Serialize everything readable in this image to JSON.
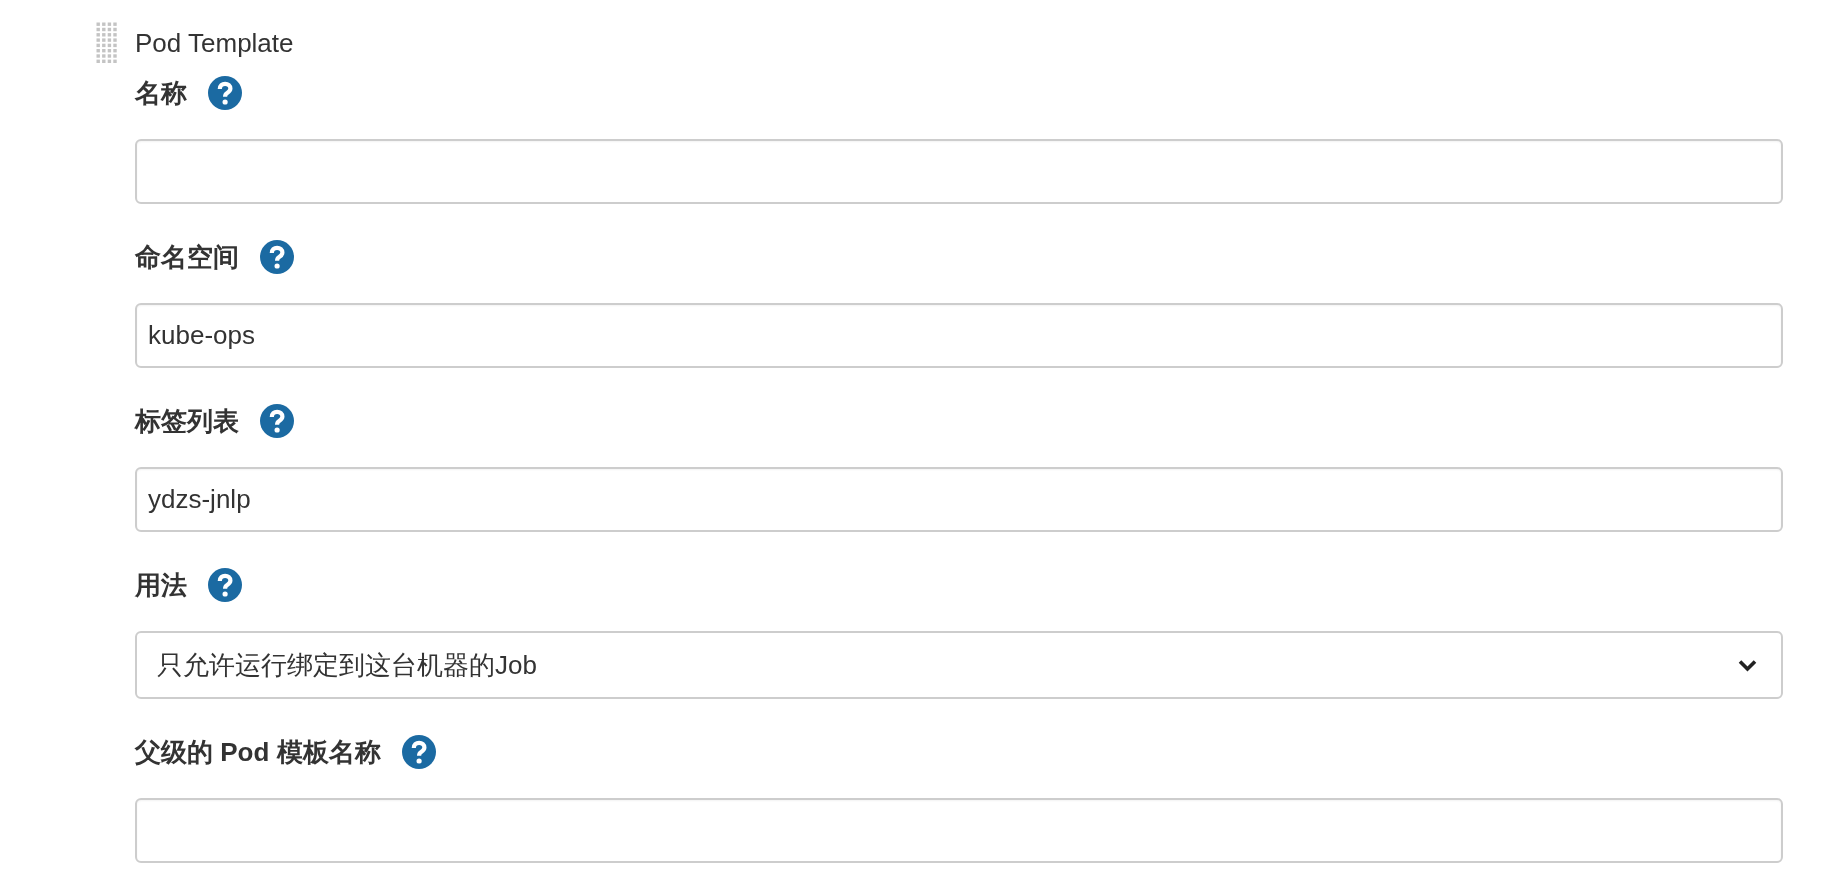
{
  "section": {
    "title": "Pod Template"
  },
  "fields": [
    {
      "kind": "text",
      "label": "名称"
    },
    {
      "kind": "text",
      "label": "命名空间",
      "value": "kube-ops"
    },
    {
      "kind": "text",
      "label": "标签列表",
      "value": "ydzs-jnlp"
    },
    {
      "kind": "select",
      "label": "用法",
      "value": "只允许运行绑定到这台机器的Job"
    },
    {
      "kind": "text",
      "label": "父级的 Pod 模板名称"
    }
  ]
}
